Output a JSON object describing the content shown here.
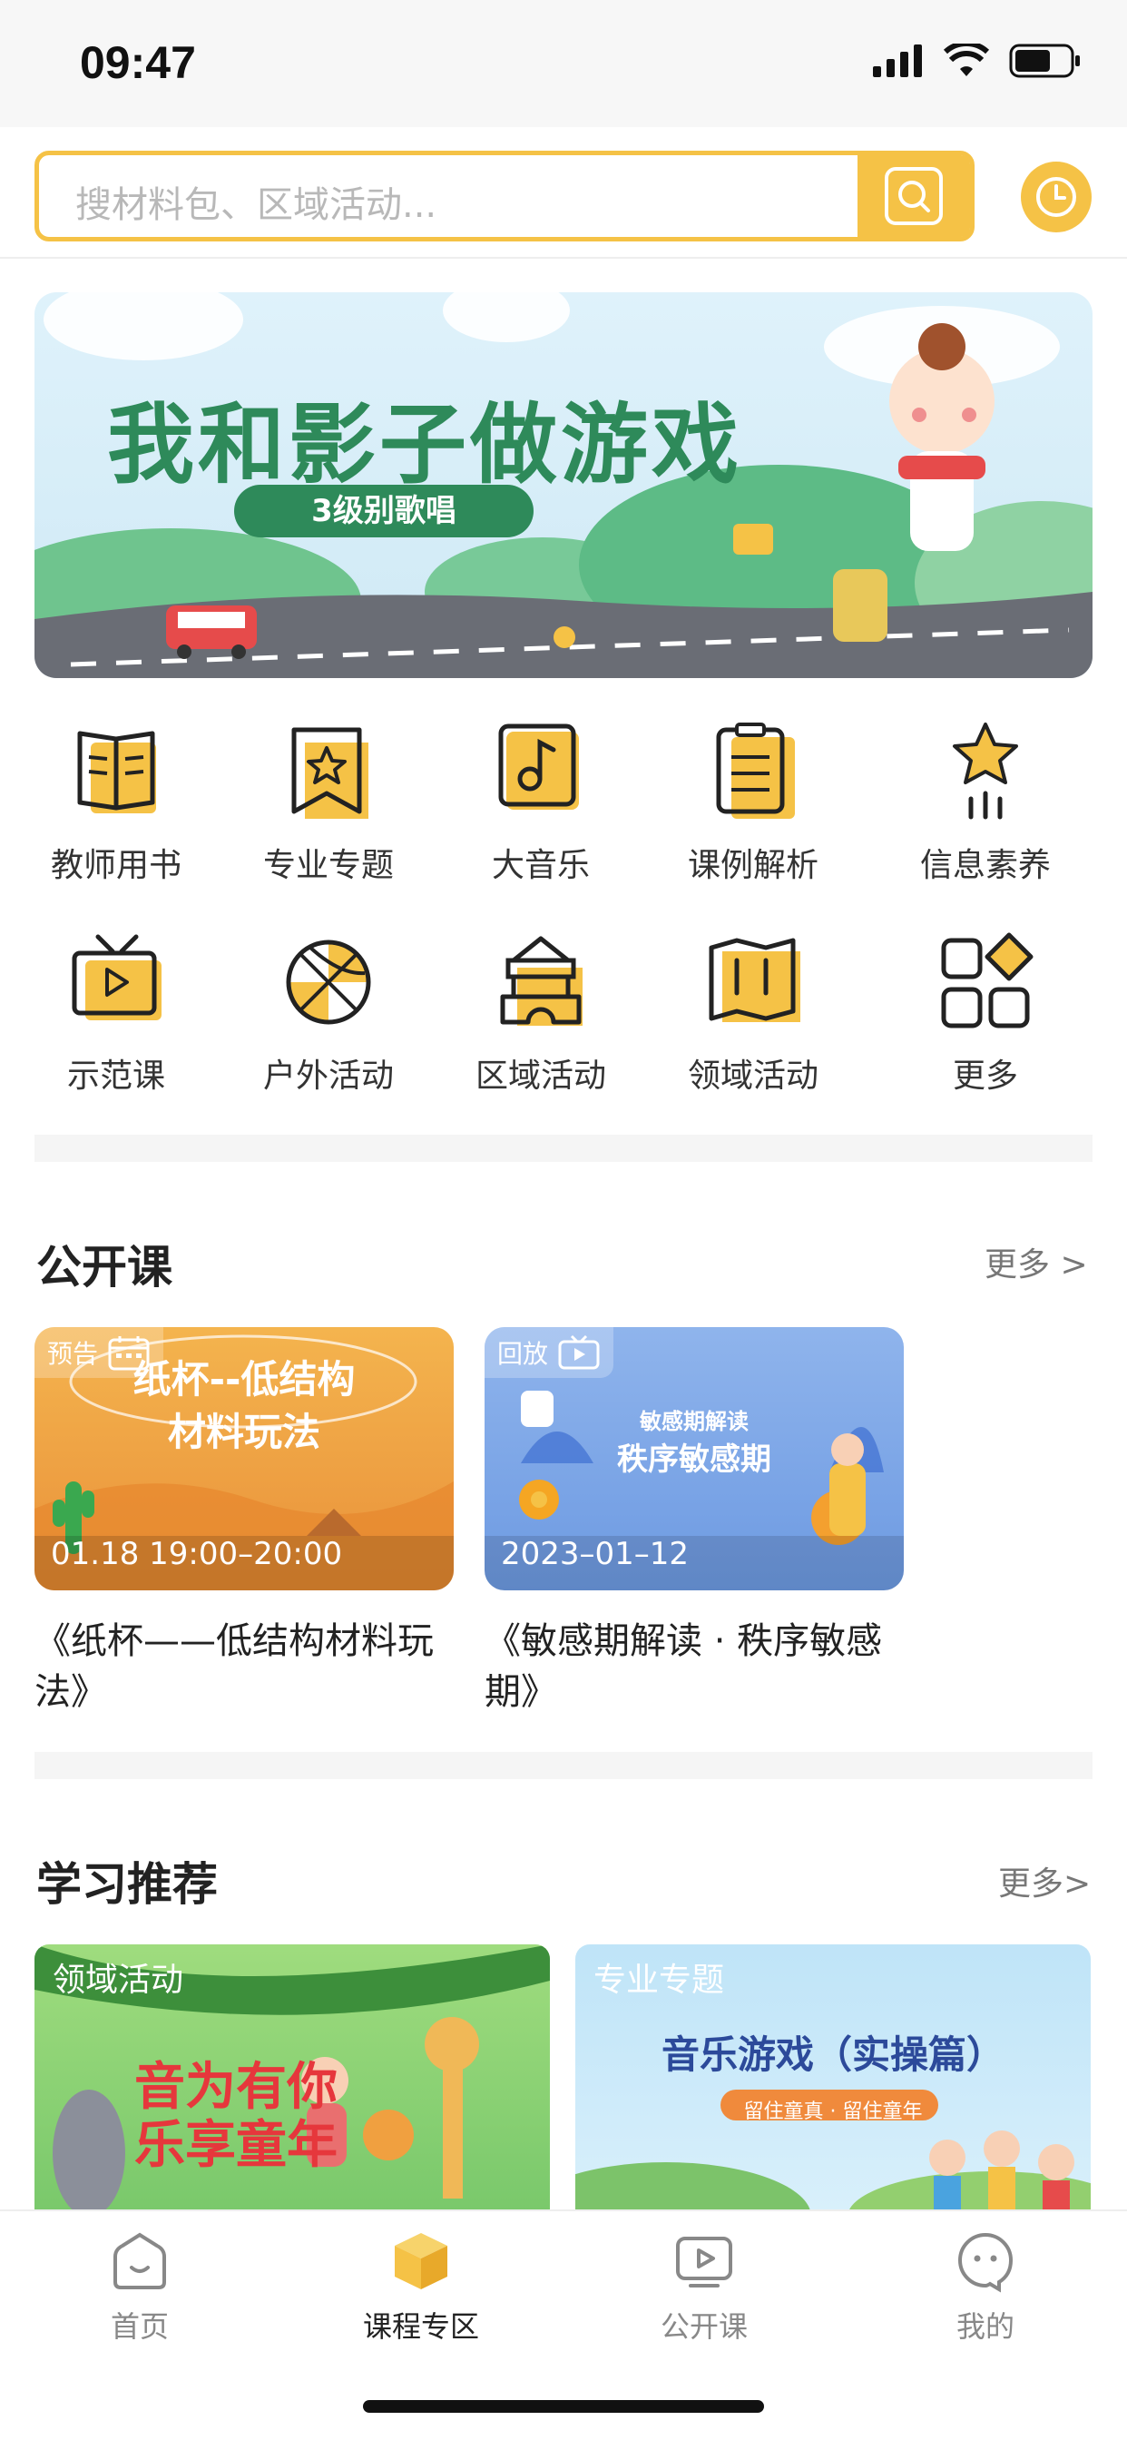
{
  "status": {
    "time": "09:47"
  },
  "search": {
    "placeholder": "搜材料包、区域活动..."
  },
  "banner": {
    "title": "我和影子做游戏",
    "subtitle": "3级别歌唱"
  },
  "grid": [
    {
      "label": "教师用书",
      "icon": "book-icon"
    },
    {
      "label": "专业专题",
      "icon": "bookmark-star-icon"
    },
    {
      "label": "大音乐",
      "icon": "music-note-icon"
    },
    {
      "label": "课例解析",
      "icon": "clipboard-icon"
    },
    {
      "label": "信息素养",
      "icon": "star-signal-icon"
    },
    {
      "label": "示范课",
      "icon": "tv-play-icon"
    },
    {
      "label": "户外活动",
      "icon": "basketball-icon"
    },
    {
      "label": "区域活动",
      "icon": "building-blocks-icon"
    },
    {
      "label": "领域活动",
      "icon": "map-icon"
    },
    {
      "label": "更多",
      "icon": "apps-grid-icon"
    }
  ],
  "open_class": {
    "title": "公开课",
    "more": "更多 >",
    "items": [
      {
        "tag": "预告",
        "thumb_title_1": "纸杯--低结构",
        "thumb_title_2": "材料玩法",
        "time": "01.18 19:00–20:00",
        "name": "《纸杯——低结构材料玩法》"
      },
      {
        "tag": "回放",
        "thumb_title_1": "敏感期解读",
        "thumb_title_2": "秩序敏感期",
        "time": "2023–01–12",
        "name": "《敏感期解读 · 秩序敏感期》"
      }
    ]
  },
  "recommend": {
    "title": "学习推荐",
    "more": "更多>",
    "items": [
      {
        "tag": "领域活动",
        "thumb_title_1": "音为有你",
        "thumb_title_2": "乐享童年"
      },
      {
        "tag": "专业专题",
        "thumb_title_1": "音乐游戏（实操篇）",
        "thumb_title_2": "留住童真 · 留住童年"
      }
    ]
  },
  "tabs": [
    {
      "label": "首页",
      "icon": "home-face-icon"
    },
    {
      "label": "课程专区",
      "icon": "cube-icon"
    },
    {
      "label": "公开课",
      "icon": "tv-play-icon"
    },
    {
      "label": "我的",
      "icon": "profile-face-icon"
    }
  ],
  "colors": {
    "accent": "#f5c246",
    "banner_green": "#2e8a5a"
  }
}
